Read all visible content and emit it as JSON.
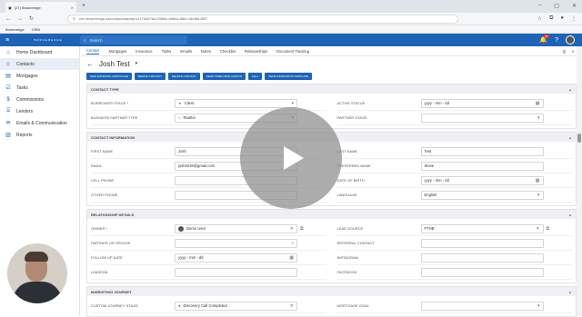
{
  "browser": {
    "tab_title": "(27) Brokeredge",
    "url": "crm.brokeredge.ca/contact/display/12175/8/?id=2f96dc-b58ca-58ef-18ef8d-f807",
    "bookmarks": [
      "Brokeredge",
      "CRM"
    ]
  },
  "app": {
    "logo_text": "BROKEREDGE",
    "search_placeholder": "Search",
    "notifications_count": "27"
  },
  "sidebar": {
    "items": [
      {
        "label": "Home Dashboard",
        "icon": "home-icon"
      },
      {
        "label": "Contacts",
        "icon": "contacts-icon"
      },
      {
        "label": "Mortgages",
        "icon": "mortgages-icon"
      },
      {
        "label": "Tasks",
        "icon": "tasks-icon"
      },
      {
        "label": "Commissions",
        "icon": "dollar-icon"
      },
      {
        "label": "Lenders",
        "icon": "bank-icon"
      },
      {
        "label": "Emails & Communication",
        "icon": "mail-icon"
      },
      {
        "label": "Reports",
        "icon": "reports-icon"
      }
    ]
  },
  "subtabs": [
    "Contact",
    "Mortgages",
    "Insurance",
    "Tasks",
    "Emails",
    "Notes",
    "Checklist",
    "Relationships",
    "Document Tracking"
  ],
  "contact_name": "Josh Test",
  "actions": [
    "New External Mortgage",
    "Merge Contact",
    "Delete Contact",
    "Send Finmo Application",
    "Call",
    "Send Expedition Template"
  ],
  "sections": {
    "contact_type": {
      "title": "Contact Type",
      "left": [
        {
          "label": "Borrower Stage *",
          "value": "Client"
        },
        {
          "label": "Business Partner Type",
          "value": "Realtor"
        }
      ],
      "right": [
        {
          "label": "Active Status",
          "value": "yyyy - mm - dd"
        },
        {
          "label": "Partner Stage",
          "value": ""
        }
      ]
    },
    "contact_info": {
      "title": "Contact Information",
      "left": [
        {
          "label": "First Name",
          "value": "Josh"
        },
        {
          "label": "Email",
          "value": "joshmtz8@gmail.com"
        },
        {
          "label": "Cell Phone",
          "value": ""
        },
        {
          "label": "Other Phone",
          "value": ""
        }
      ],
      "right": [
        {
          "label": "Last Name",
          "value": "Test"
        },
        {
          "label": "Preferred Name",
          "value": "Steve"
        },
        {
          "label": "Date of Birth",
          "value": "yyyy - mm - dd"
        },
        {
          "label": "Language",
          "value": "English"
        }
      ]
    },
    "relationship": {
      "title": "Relationship Details",
      "left": [
        {
          "label": "Owner *",
          "value": "Demo User"
        },
        {
          "label": "Partner or Spouse",
          "value": ""
        },
        {
          "label": "Follow Up Date",
          "value": "yyyy - mm - dd"
        },
        {
          "label": "LinkedIn",
          "value": ""
        }
      ],
      "right": [
        {
          "label": "Lead Source",
          "value": "FTHB"
        },
        {
          "label": "Referral Contact",
          "value": ""
        },
        {
          "label": "Instagram",
          "value": ""
        },
        {
          "label": "Facebook",
          "value": ""
        }
      ]
    },
    "marketing": {
      "title": "Marketing Journey",
      "left": [
        {
          "label": "Custom Journey Stage",
          "value": "Discovery Call Completed"
        }
      ],
      "right": [
        {
          "label": "Mortgage Goal",
          "value": ""
        }
      ]
    }
  }
}
